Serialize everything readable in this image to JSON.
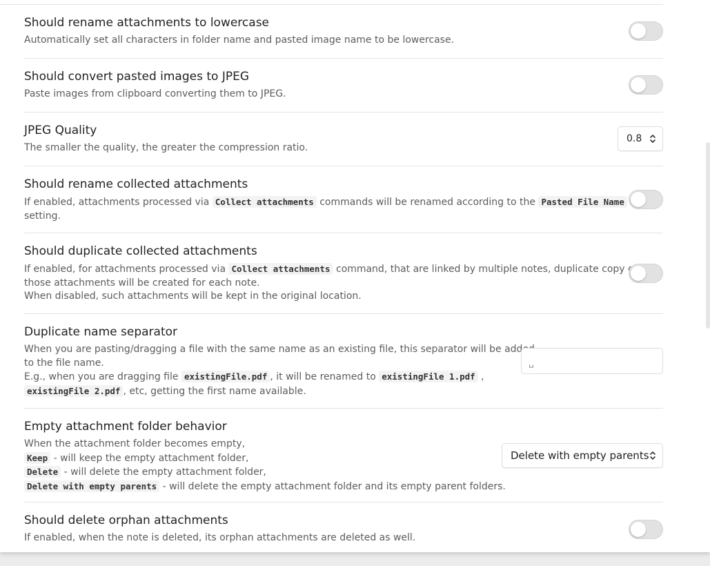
{
  "settings": {
    "rename_lowercase": {
      "name": "Should rename attachments to lowercase",
      "desc": "Automatically set all characters in folder name and pasted image name to be lowercase."
    },
    "convert_jpeg": {
      "name": "Should convert pasted images to JPEG",
      "desc": "Paste images from clipboard converting them to JPEG."
    },
    "jpeg_quality": {
      "name": "JPEG Quality",
      "desc": "The smaller the quality, the greater the compression ratio.",
      "value": "0.8"
    },
    "rename_collected": {
      "name": "Should rename collected attachments",
      "desc_part1": "If enabled, attachments processed via",
      "code1": "Collect attachments",
      "desc_part2": "commands will be renamed according to the",
      "code2": "Pasted File Name",
      "desc_part3": "setting."
    },
    "duplicate_collected": {
      "name": "Should duplicate collected attachments",
      "desc_part1": "If enabled, for attachments processed via",
      "code1": "Collect attachments",
      "desc_part2": "command, that are linked by multiple notes, duplicate copy of",
      "desc_part3": "those attachments will be created for each note.",
      "desc_part4": "When disabled, such attachments will be kept in the original location."
    },
    "duplicate_separator": {
      "name": "Duplicate name separator",
      "desc_line1": "When you are pasting/dragging a file with the same name as an existing file, this separator will be added",
      "desc_line2": "to the file name.",
      "desc_part3": "E.g., when you are dragging file",
      "code1": "existingFile.pdf",
      "desc_part4": ", it will be renamed to",
      "code2": "existingFile 1.pdf",
      "desc_part5": ",",
      "code3": "existingFile 2.pdf",
      "desc_part6": ", etc, getting the first name available.",
      "value": "␣"
    },
    "empty_folder": {
      "name": "Empty attachment folder behavior",
      "desc_line1": "When the attachment folder becomes empty,",
      "code_keep": "Keep",
      "desc_keep": "- will keep the empty attachment folder,",
      "code_delete": "Delete",
      "desc_delete": "- will delete the empty attachment folder,",
      "code_delete_parents": "Delete with empty parents",
      "desc_delete_parents": "- will delete the empty attachment folder and its empty parent folders.",
      "selected": "Delete with empty parents"
    },
    "delete_orphan": {
      "name": "Should delete orphan attachments",
      "desc": "If enabled, when the note is deleted, its orphan attachments are deleted as well."
    }
  }
}
